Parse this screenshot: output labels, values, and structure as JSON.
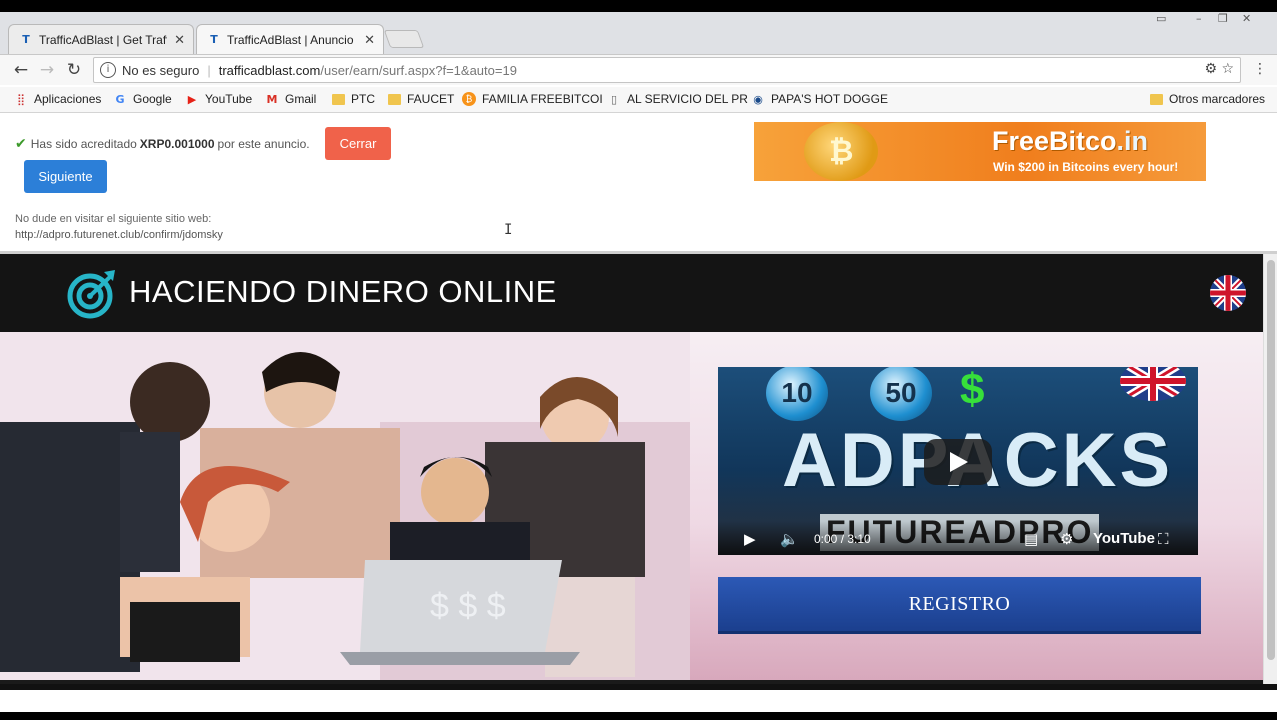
{
  "browser": {
    "tabs": [
      {
        "title": "TrafficAdBlast | Get Traffi",
        "active": false
      },
      {
        "title": "TrafficAdBlast | Anuncio",
        "active": true
      }
    ],
    "security_label": "No es seguro",
    "url_host": "trafficadblast.com",
    "url_path": "/user/earn/surf.aspx?f=1&auto=19"
  },
  "bookmarks": [
    {
      "label": "Aplicaciones",
      "icon": "apps-grid-icon"
    },
    {
      "label": "Google",
      "icon": "google-icon"
    },
    {
      "label": "YouTube",
      "icon": "youtube-icon"
    },
    {
      "label": "Gmail",
      "icon": "gmail-icon"
    },
    {
      "label": "PTC",
      "icon": "folder-icon"
    },
    {
      "label": "FAUCET",
      "icon": "folder-icon"
    },
    {
      "label": "FAMILIA FREEBITCOI",
      "icon": "bitcoin-icon"
    },
    {
      "label": "AL SERVICIO DEL PR",
      "icon": "page-icon"
    },
    {
      "label": "PAPA'S HOT DOGGE",
      "icon": "globe-icon"
    },
    {
      "label": "Otros marcadores",
      "icon": "folder-icon"
    }
  ],
  "surf": {
    "credit_prefix": "Has sido acreditado",
    "credit_amount": "XRP0.001000",
    "credit_suffix": "por este anuncio.",
    "close_label": "Cerrar",
    "next_label": "Siguiente",
    "visit_label": "No dude en visitar el siguiente sitio web:",
    "visit_url": "http://adpro.futurenet.club/confirm/jdomsky"
  },
  "ad_banner": {
    "brand_main": "FreeBitco",
    "brand_suffix": ".in",
    "tagline": "Win $200 in Bitcoins every hour!"
  },
  "site": {
    "title": "HACIENDO DINERO ONLINE",
    "register_label": "REGISTRO"
  },
  "video": {
    "ball_1": "10",
    "ball_2": "50",
    "dollar": "$",
    "headline": "ADPACKS",
    "subline": "FUTUREADPRO",
    "time": "0:00 / 3:10",
    "platform": "YouTube"
  },
  "colors": {
    "close_button": "#f0624a",
    "next_button": "#2c7fd8",
    "header_bg": "#141414",
    "register_button": "#1b3f8e",
    "accent_teal": "#27b5c8"
  }
}
